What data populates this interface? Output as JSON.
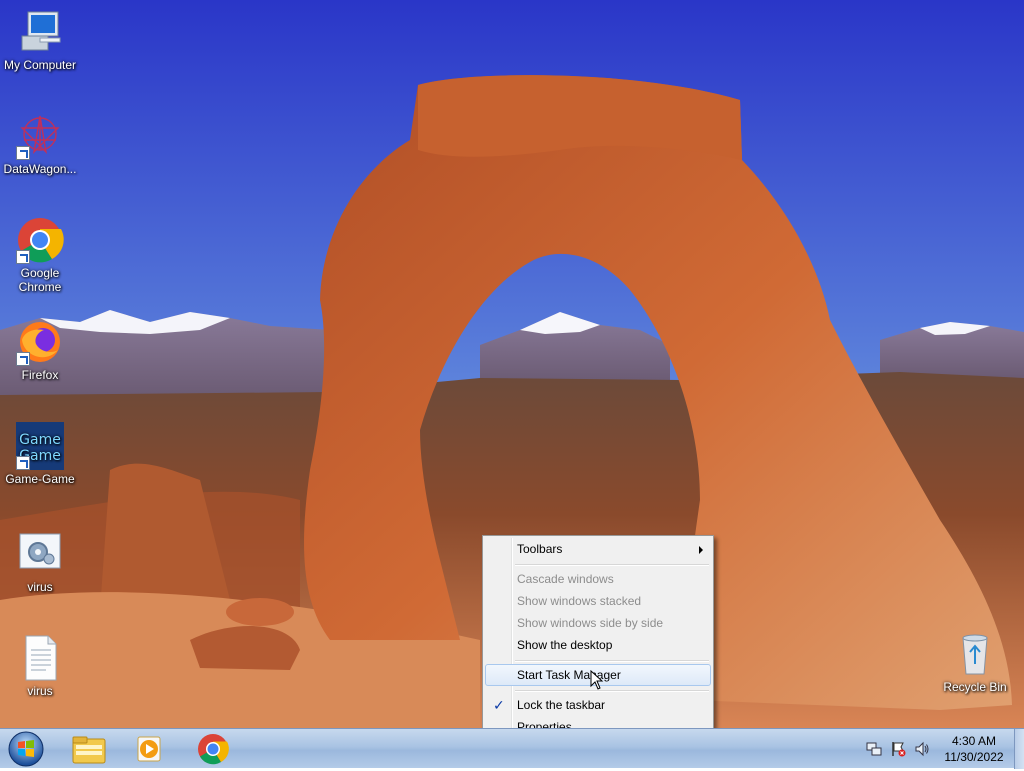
{
  "desktop": {
    "icons": [
      {
        "label": "My Computer"
      },
      {
        "label": "DataWagon..."
      },
      {
        "label": "Google Chrome"
      },
      {
        "label": "Firefox"
      },
      {
        "label": "Game-Game"
      },
      {
        "label": "virus"
      },
      {
        "label": "virus"
      },
      {
        "label": "Recycle Bin"
      }
    ],
    "gamegame_text": {
      "top": "Game",
      "bottom": "Game"
    }
  },
  "context_menu": {
    "items": [
      {
        "label": "Toolbars",
        "enabled": true,
        "submenu": true
      },
      {
        "label": "Cascade windows",
        "enabled": false
      },
      {
        "label": "Show windows stacked",
        "enabled": false
      },
      {
        "label": "Show windows side by side",
        "enabled": false
      },
      {
        "label": "Show the desktop",
        "enabled": true
      },
      {
        "label": "Start Task Manager",
        "enabled": true,
        "highlighted": true
      },
      {
        "label": "Lock the taskbar",
        "enabled": true,
        "checked": true
      },
      {
        "label": "Properties",
        "enabled": true
      }
    ],
    "check_mark": "✓"
  },
  "taskbar": {
    "clock": {
      "time": "4:30 AM",
      "date": "11/30/2022"
    },
    "pinned": [
      "windows-explorer-icon",
      "media-player-icon",
      "chrome-icon"
    ]
  },
  "colors": {
    "sky_top": "#2b3fd0",
    "sky_bottom": "#7ea6e6",
    "rock": "#c45a2a",
    "taskbar": "#a9c3e3",
    "menu_bg": "#f0f0f0"
  }
}
